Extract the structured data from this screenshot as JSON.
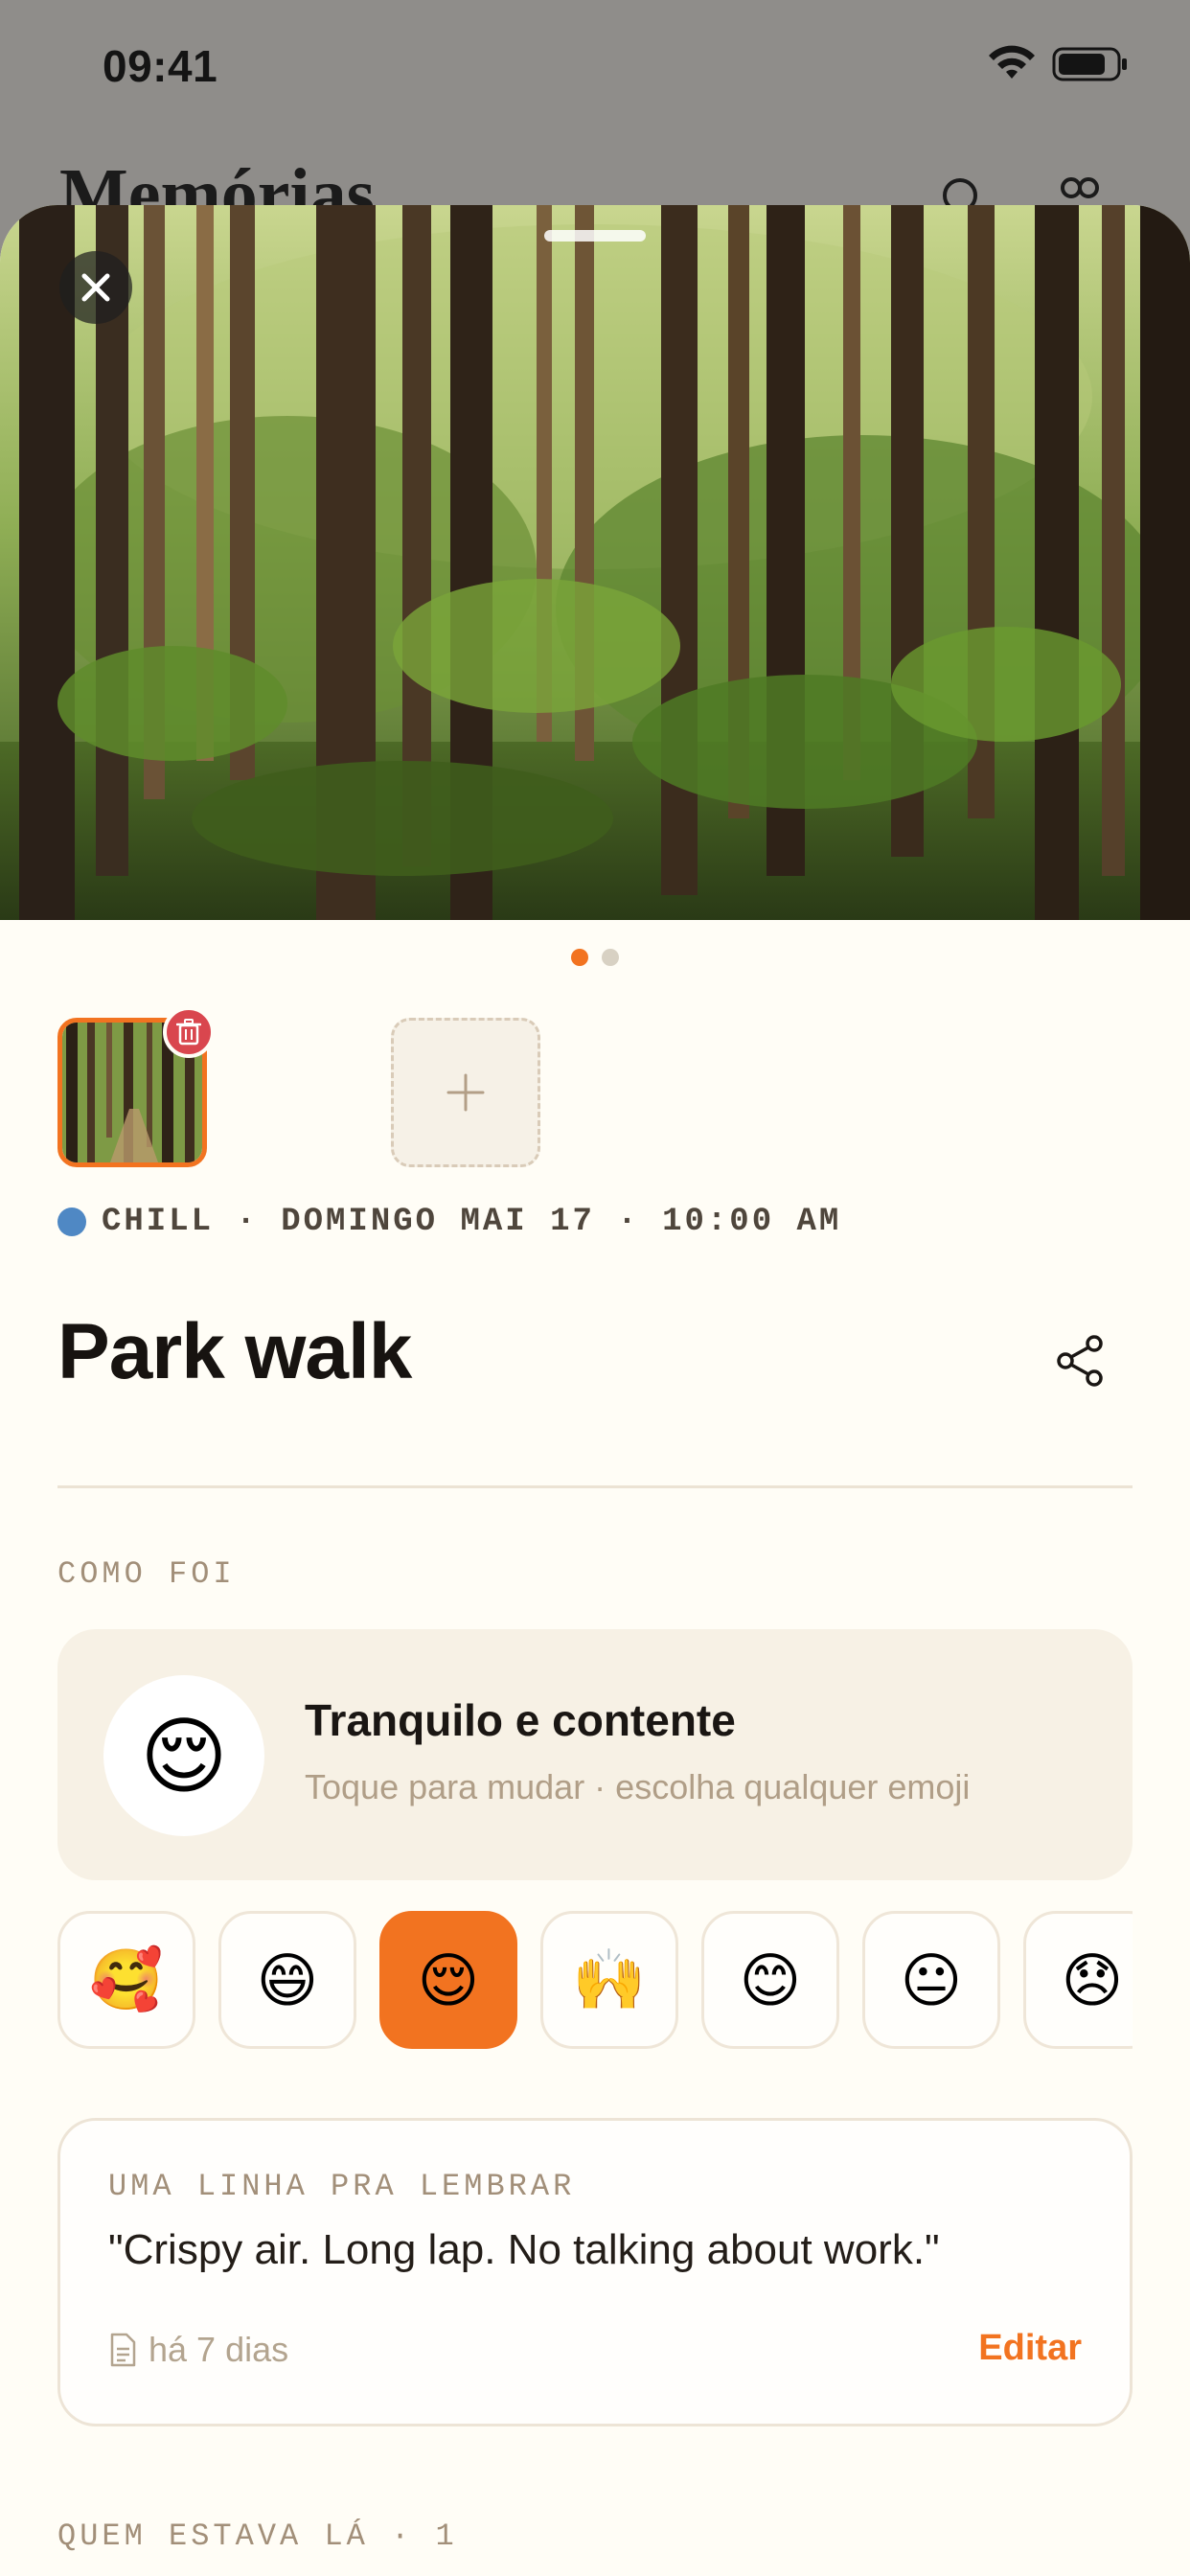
{
  "status_bar": {
    "time": "09:41"
  },
  "background": {
    "title": "Memórias"
  },
  "memory": {
    "photo_count": 2,
    "active_photo_index": 0,
    "category": "CHILL",
    "date_line": "CHILL · DOMINGO MAI 17 · 10:00 AM",
    "title": "Park walk"
  },
  "mood": {
    "section_label": "COMO FOI",
    "emoji": "😌",
    "title": "Tranquilo e contente",
    "subtitle": "Toque para mudar · escolha qualquer emoji",
    "options": [
      "🥰",
      "😄",
      "😌",
      "🙌",
      "😊",
      "😐",
      "😞"
    ],
    "selected_index": 2
  },
  "note": {
    "label": "UMA LINHA PRA LEMBRAR",
    "text": "\"Crispy air. Long lap. No talking about work.\"",
    "time": "há 7 dias",
    "edit_label": "Editar"
  },
  "people": {
    "section_label": "QUEM ESTAVA LÁ · 1"
  },
  "colors": {
    "accent": "#f27320",
    "category_dot": "#4f88c4",
    "delete": "#d9464e",
    "sheet_bg": "#fffdf6"
  },
  "icons": [
    "close-icon",
    "trash-icon",
    "plus-icon",
    "share-icon",
    "document-icon",
    "search-icon",
    "people-icon",
    "wifi-icon",
    "battery-icon"
  ]
}
